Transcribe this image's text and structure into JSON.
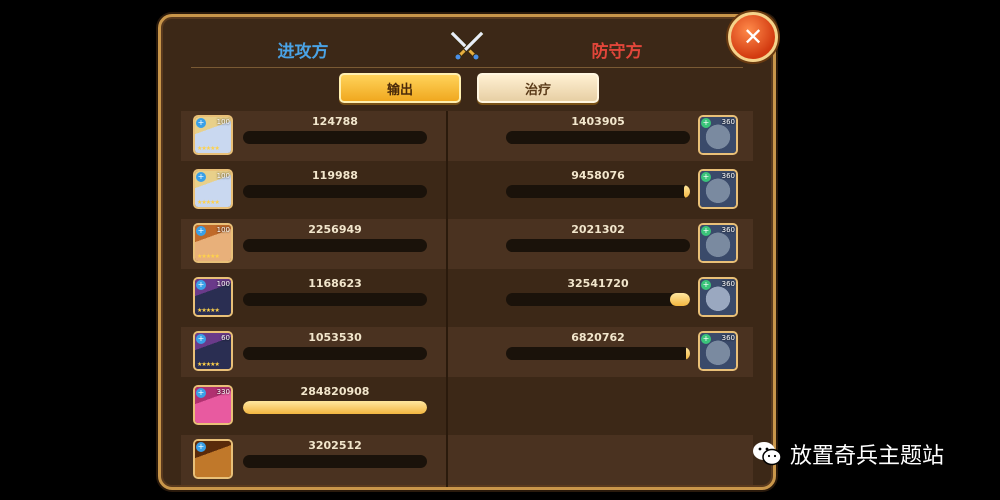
{
  "header": {
    "attacker_label": "进攻方",
    "defender_label": "防守方",
    "swords_icon": "crossed-swords-icon",
    "close_icon": "close-icon",
    "close_glyph": "✕"
  },
  "tabs": [
    {
      "label": "输出",
      "selected": true
    },
    {
      "label": "治疗",
      "selected": false
    }
  ],
  "attackers": [
    {
      "level": "100",
      "stars": "★★★★★",
      "value": "124788",
      "fill": 0.0,
      "face": "#c9d8f0",
      "hair": "#e8d08a"
    },
    {
      "level": "100",
      "stars": "★★★★★",
      "value": "119988",
      "fill": 0.0,
      "face": "#c9d8f0",
      "hair": "#e8d08a"
    },
    {
      "level": "100",
      "stars": "★★★★★",
      "value": "2256949",
      "fill": 0.0,
      "face": "#e8b07a",
      "hair": "#c06a2a"
    },
    {
      "level": "100",
      "stars": "★★★★★",
      "value": "1168623",
      "fill": 0.0,
      "face": "#2a2e52",
      "hair": "#6a3a8a"
    },
    {
      "level": "60",
      "stars": "★★★★★",
      "value": "1053530",
      "fill": 0.0,
      "face": "#2a2e52",
      "hair": "#6a3a8a"
    },
    {
      "level": "330",
      "stars": "",
      "value": "284820908",
      "fill": 1.0,
      "face": "#e85aa0",
      "hair": "#b03070"
    },
    {
      "level": "",
      "stars": "",
      "value": "3202512",
      "fill": 0.0,
      "face": "#c0782a",
      "hair": "#5a2a0a"
    }
  ],
  "defenders": [
    {
      "level": "360",
      "value": "1403905",
      "fill": 0.0,
      "face": "#7a8aa0"
    },
    {
      "level": "360",
      "value": "9458076",
      "fill": 0.03,
      "face": "#7a8aa0"
    },
    {
      "level": "360",
      "value": "2021302",
      "fill": 0.0,
      "face": "#7a8aa0"
    },
    {
      "level": "360",
      "value": "32541720",
      "fill": 0.11,
      "face": "#9aa8c0"
    },
    {
      "level": "360",
      "value": "6820762",
      "fill": 0.02,
      "face": "#7a8aa0"
    }
  ],
  "watermark": {
    "icon": "wechat-icon",
    "text": "放置奇兵主题站"
  },
  "colors": {
    "attacker": "#4aa3e6",
    "defender": "#e2463a",
    "bar_fill": "#f3b640",
    "panel": "#3c2817",
    "border": "#c9964a"
  }
}
